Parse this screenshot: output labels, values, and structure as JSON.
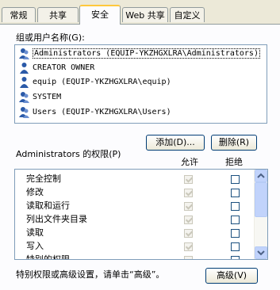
{
  "tabs": [
    {
      "label": "常规"
    },
    {
      "label": "共享"
    },
    {
      "label": "安全"
    },
    {
      "label": "Web 共享"
    },
    {
      "label": "自定义"
    }
  ],
  "users_label": "组或用户名称(G):",
  "users": [
    {
      "name": "Administrators (EQUIP-YKZHGXLRA\\Administrators)"
    },
    {
      "name": "CREATOR OWNER"
    },
    {
      "name": "equip (EQUIP-YKZHGXLRA\\equip)"
    },
    {
      "name": "SYSTEM"
    },
    {
      "name": "Users (EQUIP-YKZHGXLRA\\Users)"
    }
  ],
  "add_button": "添加(D)...",
  "remove_button": "删除(R)",
  "permissions_for": "Administrators 的权限(P)",
  "allow_header": "允许",
  "deny_header": "拒绝",
  "permissions": [
    {
      "name": "完全控制",
      "allow": true,
      "deny": false
    },
    {
      "name": "修改",
      "allow": true,
      "deny": false
    },
    {
      "name": "读取和运行",
      "allow": true,
      "deny": false
    },
    {
      "name": "列出文件夹目录",
      "allow": true,
      "deny": false
    },
    {
      "name": "读取",
      "allow": true,
      "deny": false
    },
    {
      "name": "写入",
      "allow": true,
      "deny": false
    },
    {
      "name": "特别的权限",
      "allow": false,
      "deny": false
    }
  ],
  "advanced_hint": "特别权限或高级设置，请单击“高级”。",
  "advanced_button": "高级(V)",
  "colors": {
    "tab_accent": "#ffc83c",
    "border": "#7f9db9",
    "scrollbar": "#c1d3fb"
  }
}
